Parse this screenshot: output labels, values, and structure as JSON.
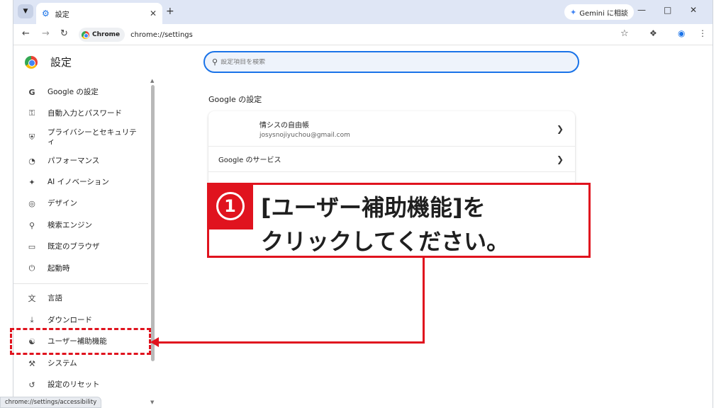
{
  "browser": {
    "tab_title": "設定",
    "omnibox_chip": "Chrome",
    "url": "chrome://settings",
    "gemini_button": "Gemini に相談",
    "status_url": "chrome://settings/accessibility"
  },
  "settings": {
    "title": "設定",
    "search_placeholder": "設定項目を検索",
    "section_title": "Google の設定",
    "account_name": "情シスの自由帳",
    "account_email": "josysnojiyuchou@gmail.com",
    "google_services": "Google のサービス",
    "nav_items": [
      {
        "label": "Google の設定",
        "icon": "google-g-icon"
      },
      {
        "label": "自動入力とパスワード",
        "icon": "key-icon"
      },
      {
        "label": "プライバシーとセキュリティ",
        "icon": "shield-icon"
      },
      {
        "label": "パフォーマンス",
        "icon": "speedometer-icon"
      },
      {
        "label": "AI イノベーション",
        "icon": "sparkle-icon"
      },
      {
        "label": "デザイン",
        "icon": "palette-icon"
      },
      {
        "label": "検索エンジン",
        "icon": "search-icon"
      },
      {
        "label": "既定のブラウザ",
        "icon": "browser-window-icon"
      },
      {
        "label": "起動時",
        "icon": "power-icon"
      },
      {
        "label": "言語",
        "icon": "translate-icon"
      },
      {
        "label": "ダウンロード",
        "icon": "download-icon"
      },
      {
        "label": "ユーザー補助機能",
        "icon": "accessibility-icon"
      },
      {
        "label": "システム",
        "icon": "wrench-icon"
      },
      {
        "label": "設定のリセット",
        "icon": "reset-icon"
      }
    ]
  },
  "callout": {
    "number": "1",
    "line1": "[ユーザー補助機能]を",
    "line2": "クリックしてください。",
    "color": "#e0131e"
  }
}
